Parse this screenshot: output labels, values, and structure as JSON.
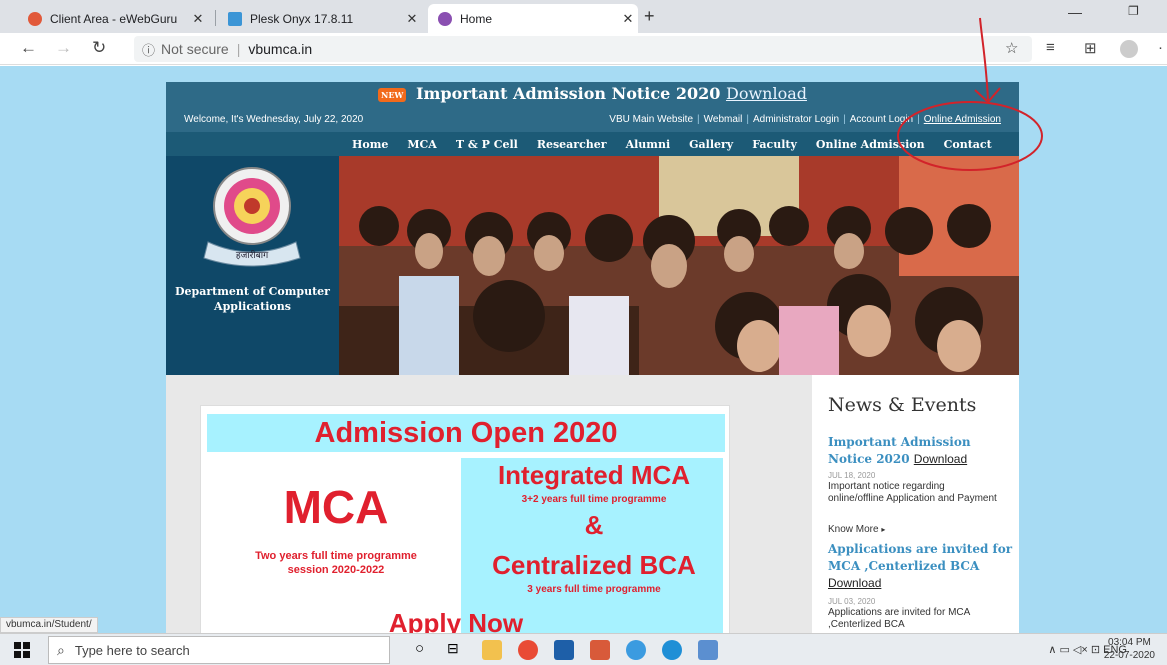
{
  "browser": {
    "tabs": [
      {
        "title": "Client Area - eWebGuru",
        "favicon_color": "#e1593a"
      },
      {
        "title": "Plesk Onyx 17.8.11",
        "favicon_color": "#3b95d6"
      },
      {
        "title": "Home",
        "favicon_color": "#8a4fb1"
      }
    ],
    "new_tab": "+",
    "security_label": "Not secure",
    "url": "vbumca.in"
  },
  "site": {
    "notice_badge": "NEW",
    "notice_title": "Important Admission Notice 2020",
    "notice_link": "Download",
    "welcome": "Welcome, It's Wednesday, July 22, 2020",
    "top_links": [
      "VBU Main Website",
      "Webmail",
      "Administrator Login",
      "Account Login",
      "Online Admission"
    ],
    "menu": [
      "Home",
      "MCA",
      "T & P Cell",
      "Researcher",
      "Alumni",
      "Gallery",
      "Faculty",
      "Online Admission",
      "Contact"
    ],
    "emblem_caption": "हजारीबाग",
    "dept_name": "Department of Computer Applications"
  },
  "poster": {
    "title": "Admission Open 2020",
    "mca": "MCA",
    "mca_desc1": "Two years full time programme",
    "mca_desc2": "session 2020-2022",
    "integrated": "Integrated MCA",
    "integrated_desc": "3+2 years full time programme",
    "amp": "&",
    "centralized": "Centralized BCA",
    "centralized_desc": "3 years full time programme",
    "apply": "Apply Now"
  },
  "news": {
    "heading": "News & Events",
    "items": [
      {
        "title": "Important Admission Notice 2020",
        "link": "Download",
        "date": "JUL 18, 2020",
        "desc": "Important notice regarding online/offline Application and Payment",
        "more": "Know More"
      },
      {
        "title": "Applications are invited for MCA ,Centerlized BCA",
        "link": "Download",
        "date": "JUL 03, 2020",
        "desc": "Applications are invited for MCA ,Centerlized BCA"
      }
    ]
  },
  "status_url": "vbumca.in/Student/",
  "taskbar": {
    "search_placeholder": "Type here to search",
    "language": "ENG",
    "time": "03:04 PM",
    "date": "22-07-2020"
  }
}
